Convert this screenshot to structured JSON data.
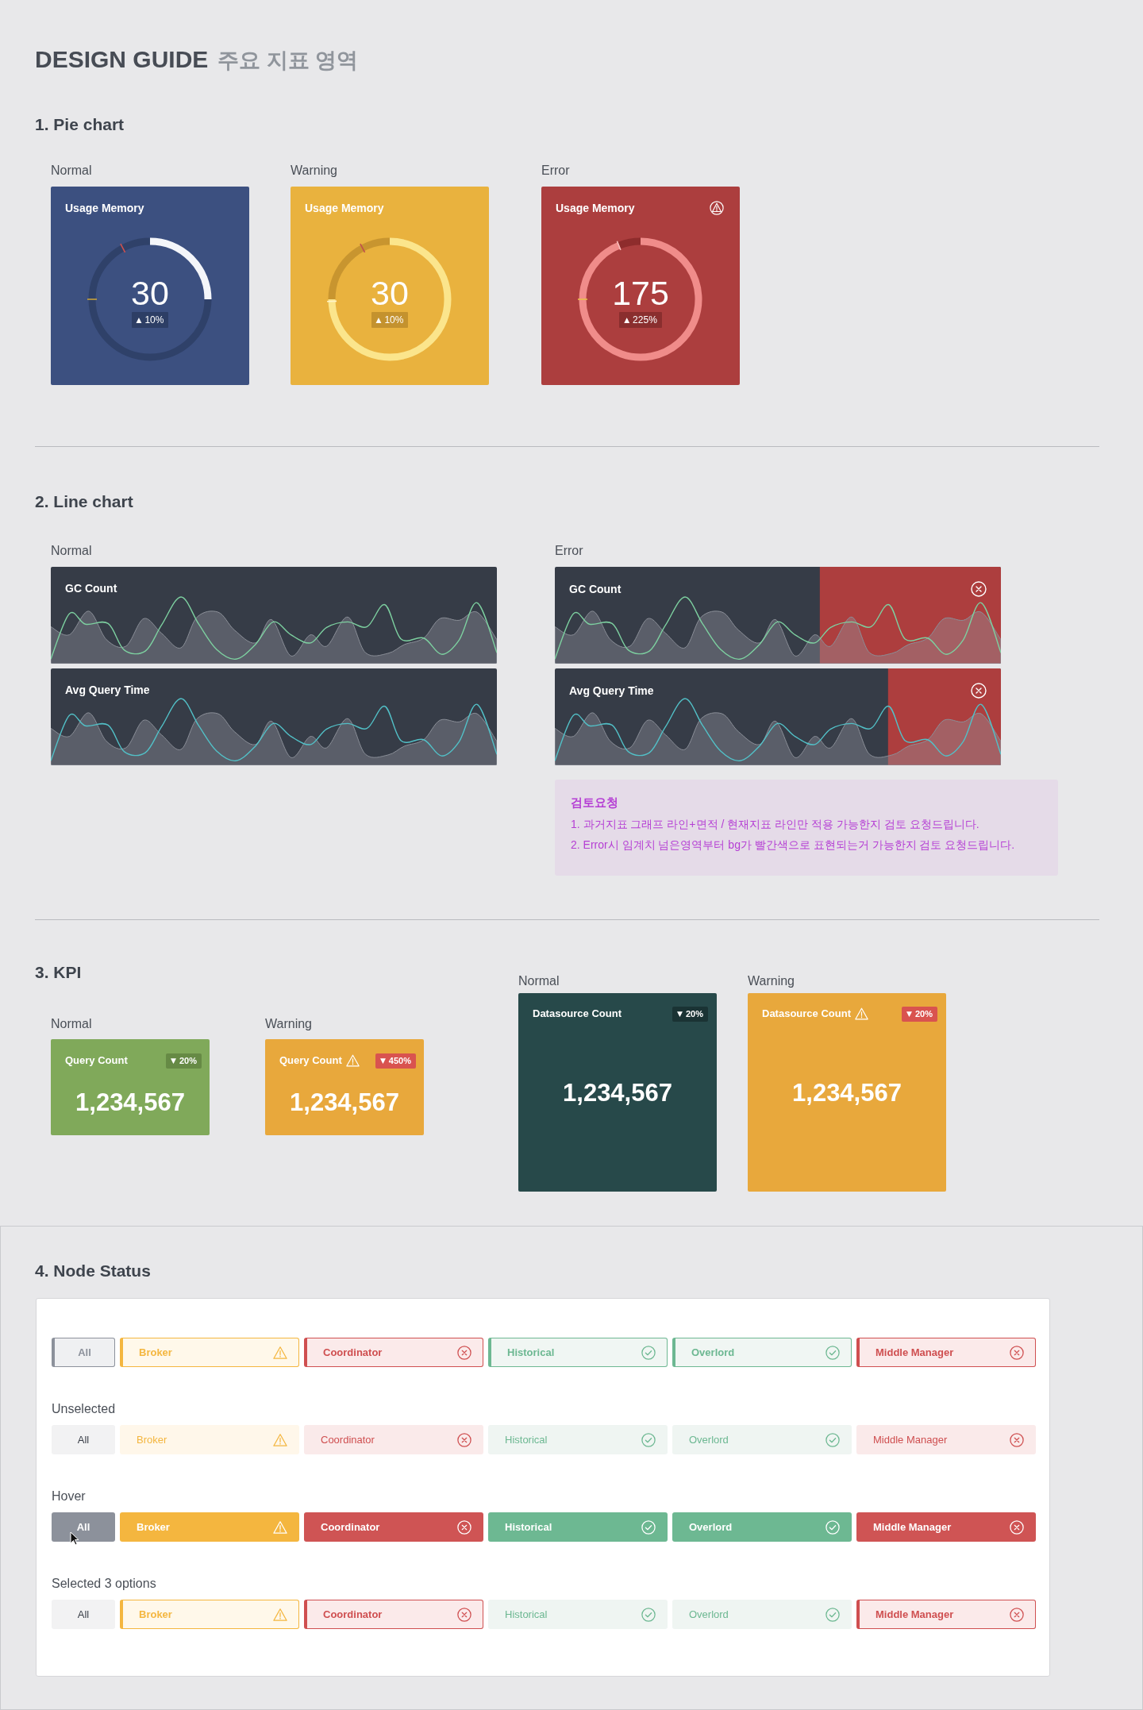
{
  "header": {
    "title": "DESIGN GUIDE",
    "subtitle": "주요 지표 영역"
  },
  "pie_section": {
    "heading": "1. Pie chart",
    "cards": [
      {
        "kind": "normal",
        "label": "Normal",
        "title": "Usage Memory",
        "value": "30",
        "arrow": "▲",
        "change": "10%"
      },
      {
        "kind": "warning",
        "label": "Warning",
        "title": "Usage Memory",
        "value": "30",
        "arrow": "▲",
        "change": "10%"
      },
      {
        "kind": "error",
        "label": "Error",
        "title": "Usage Memory",
        "value": "175",
        "arrow": "▲",
        "change": "225%"
      }
    ]
  },
  "line_section": {
    "heading": "2. Line chart",
    "groups": [
      {
        "label": "Normal",
        "charts": [
          {
            "title": "GC Count",
            "color": "#7dd0a0",
            "alert": false
          },
          {
            "title": "Avg Query Time",
            "color": "#52c0c7",
            "alert": false
          }
        ]
      },
      {
        "label": "Error",
        "charts": [
          {
            "title": "GC Count",
            "color": "#7dd0a0",
            "alert": true
          },
          {
            "title": "Avg Query Time",
            "color": "#52c0c7",
            "alert": true
          }
        ],
        "note": {
          "title": "검토요청",
          "lines": [
            "1. 과거지표 그래프 라인+면적 / 현재지표 라인만 적용 가능한지 검토 요청드립니다.",
            "2. Error시 임계치 넘은영역부터 bg가 빨간색으로 표현되는거 가능한지 검토 요청드립니다."
          ]
        }
      }
    ]
  },
  "kpi_section": {
    "heading": "3. KPI",
    "compact_cards": [
      {
        "kind": "normal",
        "label": "Normal",
        "title": "Query Count",
        "arrow": "▼",
        "change": "20%",
        "value": "1,234,567"
      },
      {
        "kind": "warning",
        "label": "Warning",
        "title": "Query Count",
        "arrow": "▼",
        "change": "450%",
        "value": "1,234,567"
      }
    ],
    "large_cards": [
      {
        "kind": "normal",
        "label": "Normal",
        "title": "Datasource Count",
        "arrow": "▼",
        "change": "20%",
        "value": "1,234,567"
      },
      {
        "kind": "warning",
        "label": "Warning",
        "title": "Datasource Count",
        "arrow": "▼",
        "change": "20%",
        "value": "1,234,567"
      }
    ]
  },
  "node_status": {
    "heading": "4. Node Status",
    "groups": [
      {
        "cursor": false,
        "chips": [
          {
            "label": "All",
            "kind": "all",
            "selected": true,
            "hovered": false
          },
          {
            "label": "Broker",
            "kind": "warning",
            "selected": true,
            "hovered": false
          },
          {
            "label": "Coordinator",
            "kind": "error",
            "selected": true,
            "hovered": false
          },
          {
            "label": "Historical",
            "kind": "ok",
            "selected": true,
            "hovered": false
          },
          {
            "label": "Overlord",
            "kind": "ok",
            "selected": true,
            "hovered": false
          },
          {
            "label": "Middle Manager",
            "kind": "error",
            "selected": true,
            "hovered": false
          }
        ]
      },
      {
        "label": "Unselected",
        "cursor": false,
        "chips": [
          {
            "label": "All",
            "kind": "all",
            "selected": false,
            "hovered": false
          },
          {
            "label": "Broker",
            "kind": "warning",
            "selected": false,
            "hovered": false
          },
          {
            "label": "Coordinator",
            "kind": "error",
            "selected": false,
            "hovered": false
          },
          {
            "label": "Historical",
            "kind": "ok",
            "selected": false,
            "hovered": false
          },
          {
            "label": "Overlord",
            "kind": "ok",
            "selected": false,
            "hovered": false
          },
          {
            "label": "Middle Manager",
            "kind": "error",
            "selected": false,
            "hovered": false
          }
        ]
      },
      {
        "label": "Hover",
        "cursor": true,
        "chips": [
          {
            "label": "All",
            "kind": "all",
            "selected": false,
            "hovered": true
          },
          {
            "label": "Broker",
            "kind": "warning",
            "selected": false,
            "hovered": true
          },
          {
            "label": "Coordinator",
            "kind": "error",
            "selected": false,
            "hovered": true
          },
          {
            "label": "Historical",
            "kind": "ok",
            "selected": false,
            "hovered": true
          },
          {
            "label": "Overlord",
            "kind": "ok",
            "selected": false,
            "hovered": true
          },
          {
            "label": "Middle Manager",
            "kind": "error",
            "selected": false,
            "hovered": true
          }
        ]
      },
      {
        "label": "Selected 3 options",
        "cursor": false,
        "chips": [
          {
            "label": "All",
            "kind": "all",
            "selected": false,
            "hovered": false
          },
          {
            "label": "Broker",
            "kind": "warning",
            "selected": true,
            "hovered": false
          },
          {
            "label": "Coordinator",
            "kind": "error",
            "selected": true,
            "hovered": false
          },
          {
            "label": "Historical",
            "kind": "ok",
            "selected": false,
            "hovered": false
          },
          {
            "label": "Overlord",
            "kind": "ok",
            "selected": false,
            "hovered": false
          },
          {
            "label": "Middle Manager",
            "kind": "error",
            "selected": true,
            "hovered": false
          }
        ]
      }
    ]
  }
}
